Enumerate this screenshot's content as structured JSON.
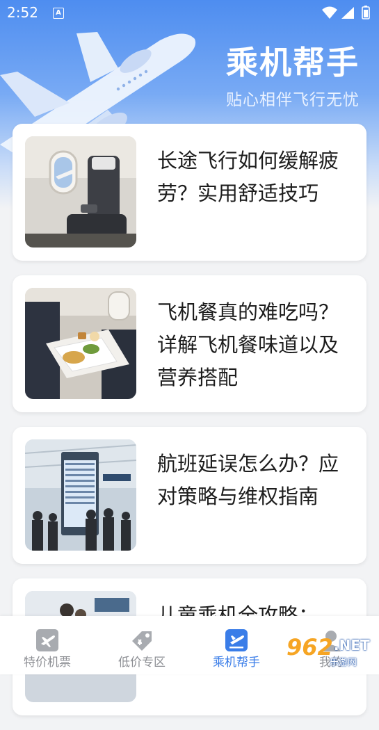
{
  "status_bar": {
    "time": "2:52",
    "notification_badge": "A"
  },
  "hero": {
    "title": "乘机帮手",
    "subtitle": "贴心相伴飞行无忧"
  },
  "articles": [
    {
      "title": "长途飞行如何缓解疲劳？实用舒适技巧",
      "image": "airplane-seat-window"
    },
    {
      "title": "飞机餐真的难吃吗？详解飞机餐味道以及营养搭配",
      "image": "inflight-meal-tray"
    },
    {
      "title": "航班延误怎么办？应对策略与维权指南",
      "image": "airport-departure-board"
    },
    {
      "title": "儿童乘机全攻略：",
      "image": "airport-terminal-family"
    }
  ],
  "tabbar": {
    "tabs": [
      {
        "label": "特价机票",
        "icon": "plane-ticket-icon"
      },
      {
        "label": "低价专区",
        "icon": "price-tag-icon"
      },
      {
        "label": "乘机帮手",
        "icon": "boarding-icon"
      },
      {
        "label": "我的",
        "icon": "profile-icon"
      }
    ],
    "active_index": 2
  },
  "watermark": {
    "number": "962",
    "net": ".NET",
    "site": "乐游网"
  },
  "colors": {
    "accent": "#3a7de8",
    "tab_inactive": "#8d8f94",
    "hero_top": "#4e8df0"
  }
}
